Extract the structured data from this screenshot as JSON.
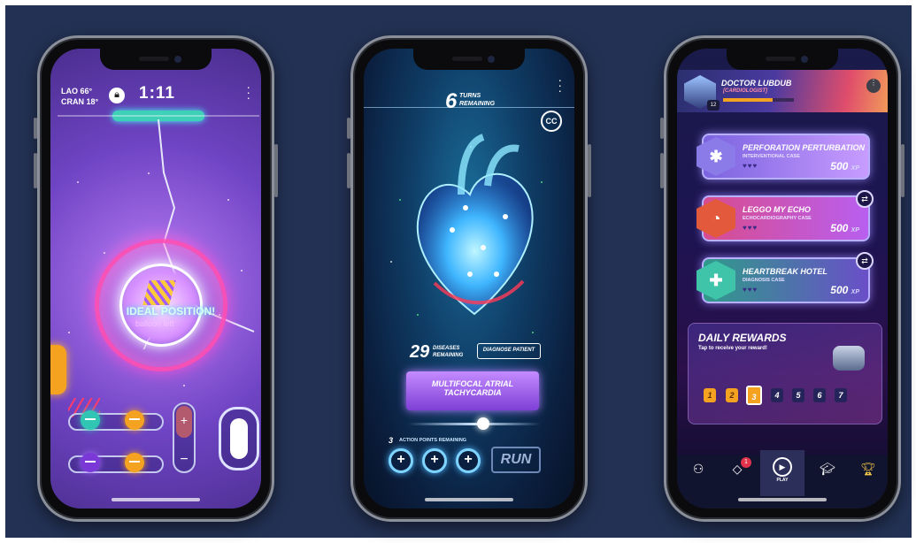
{
  "phone1": {
    "stat_line1_label": "LAO",
    "stat_line1_value": "66°",
    "stat_line2_label": "CRAN",
    "stat_line2_value": "18°",
    "timer": "1:11",
    "message": "IDEAL POSITION!",
    "subtitle": "balloon left"
  },
  "phone2": {
    "turns_count": "6",
    "turns_label_1": "TURNS",
    "turns_label_2": "REMAINING",
    "cc_label": "CC",
    "diseases_count": "29",
    "diseases_label_1": "DISEASES",
    "diseases_label_2": "REMAINING",
    "diagnose_button": "DIAGNOSE PATIENT",
    "diagnosis_line1": "MULTIFOCAL ATRIAL",
    "diagnosis_line2": "TACHYCARDIA",
    "action_points_count": "3",
    "action_points_label": "ACTION POINTS REMAINING",
    "run_button": "RUN"
  },
  "phone3": {
    "player_name": "DOCTOR LUBDUB",
    "player_role": "[CARDIOLOGIST]",
    "player_level": "12",
    "cases": [
      {
        "title": "PERFORATION PERTURBATION",
        "type": "INTERVENTIONAL CASE",
        "xp": "500",
        "xp_unit": "XP"
      },
      {
        "title": "LEGGO MY ECHO",
        "type": "ECHOCARDIOGRAPHY CASE",
        "xp": "500",
        "xp_unit": "XP"
      },
      {
        "title": "HEARTBREAK HOTEL",
        "type": "DIAGNOSIS CASE",
        "xp": "500",
        "xp_unit": "XP"
      }
    ],
    "daily_title": "DAILY REWARDS",
    "daily_sub": "Tap to receive your reward!",
    "days": [
      "1",
      "2",
      "3",
      "4",
      "5",
      "6",
      "7"
    ],
    "nav_notification": "1",
    "nav_play_label": "PLAY",
    "colors": {
      "accent": "#f4a21f",
      "play_active": "#2b2f5a"
    }
  }
}
